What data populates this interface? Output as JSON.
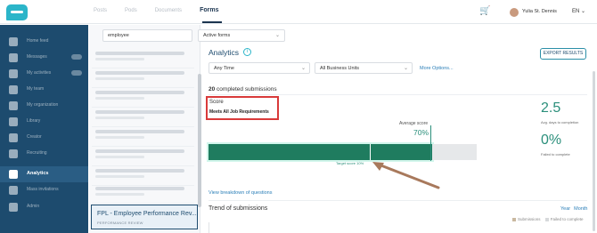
{
  "header": {
    "nav": [
      "Posts",
      "Pods",
      "Documents"
    ],
    "active_nav": "Forms",
    "user": "Yulia St. Dennis",
    "lang": "EN",
    "cart_icon": "cart-icon"
  },
  "sidebar": {
    "items": [
      {
        "label": "Home feed",
        "badge": false
      },
      {
        "label": "Messages",
        "badge": true
      },
      {
        "label": "My activities",
        "badge": true
      },
      {
        "label": "My team",
        "badge": false
      },
      {
        "label": "My organization",
        "badge": false
      },
      {
        "label": "Library",
        "badge": false
      },
      {
        "label": "Creator",
        "badge": false
      },
      {
        "label": "Recruiting",
        "badge": false
      },
      {
        "label": "Analytics",
        "badge": false,
        "active": true
      },
      {
        "label": "Mass invitations",
        "badge": false
      },
      {
        "label": "Admin",
        "badge": false
      }
    ]
  },
  "list": {
    "search_value": "employee",
    "filter_value": "Active forms",
    "selected_title": "FPL - Employee Performance Rev...",
    "selected_subtitle": "PERFORMANCE REVIEW"
  },
  "main": {
    "title": "Analytics",
    "export_label": "EXPORT RESULTS",
    "time_filter": "Any Time",
    "unit_filter": "All Business Units",
    "more_options": "More Options...",
    "completed_count": "20",
    "completed_text": "completed submissions",
    "score_label": "Score",
    "score_value": "Meets All Job Requirements",
    "avg_label": "Average score",
    "avg_value": "70%",
    "target_label": "Target score 10%",
    "breakdown_link": "View breakdown of questions",
    "trend_title": "Trend of submissions",
    "year_label": "Year",
    "month_label": "Month",
    "legend_submissions": "Submissions",
    "legend_failed": "Failed to complete",
    "kpi_days_value": "2.5",
    "kpi_days_label": "Avg. days to completion",
    "kpi_failed_value": "0%",
    "kpi_failed_label": "Failed to complete"
  },
  "score_bar": {
    "average_fraction": 0.7,
    "target_fraction": 0.1,
    "color": "#1f7c5f"
  },
  "colors": {
    "sidebar": "#1d4b6e",
    "accent": "#2bb5c9",
    "kpi": "#2b8f7b",
    "highlight_box": "#d93a3a",
    "arrow": "#a8795c"
  }
}
